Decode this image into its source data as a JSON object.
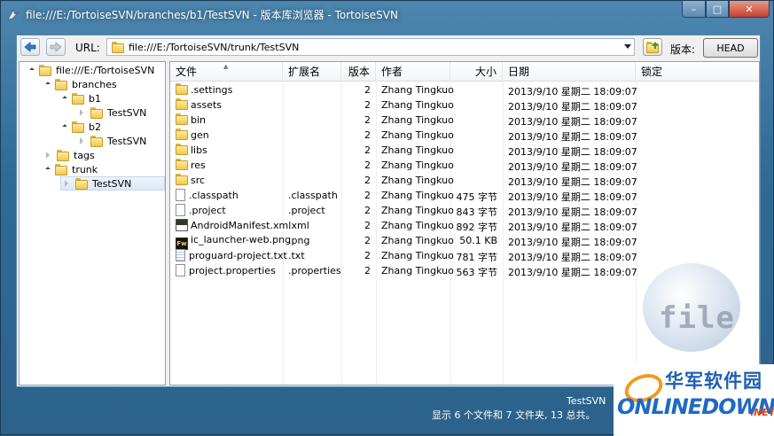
{
  "window": {
    "title": "file:///E:/TortoiseSVN/branches/b1/TestSVN - 版本库浏览器 - TortoiseSVN",
    "controls": {
      "minimize": "–",
      "maximize": "□",
      "close": "✕"
    }
  },
  "toolbar": {
    "url_label": "URL:",
    "url_value": "file:///E:/TortoiseSVN/trunk/TestSVN",
    "revision_label": "版本:",
    "revision_button": "HEAD"
  },
  "tree": {
    "nodes": [
      {
        "label": "file:///E:/TortoiseSVN"
      },
      {
        "label": "branches"
      },
      {
        "label": "b1"
      },
      {
        "label": "TestSVN"
      },
      {
        "label": "b2"
      },
      {
        "label": "TestSVN"
      },
      {
        "label": "tags"
      },
      {
        "label": "trunk"
      },
      {
        "label": "TestSVN",
        "selected": true
      }
    ]
  },
  "list": {
    "columns": [
      "文件",
      "扩展名",
      "版本",
      "作者",
      "大小",
      "日期",
      "锁定"
    ],
    "rows": [
      {
        "name": ".settings",
        "ext": "",
        "rev": "2",
        "author": "Zhang Tingkuo",
        "size": "",
        "date": "2013/9/10 星期二 18:09:07",
        "icon": "folder"
      },
      {
        "name": "assets",
        "ext": "",
        "rev": "2",
        "author": "Zhang Tingkuo",
        "size": "",
        "date": "2013/9/10 星期二 18:09:07",
        "icon": "folder"
      },
      {
        "name": "bin",
        "ext": "",
        "rev": "2",
        "author": "Zhang Tingkuo",
        "size": "",
        "date": "2013/9/10 星期二 18:09:07",
        "icon": "folder"
      },
      {
        "name": "gen",
        "ext": "",
        "rev": "2",
        "author": "Zhang Tingkuo",
        "size": "",
        "date": "2013/9/10 星期二 18:09:07",
        "icon": "folder"
      },
      {
        "name": "libs",
        "ext": "",
        "rev": "2",
        "author": "Zhang Tingkuo",
        "size": "",
        "date": "2013/9/10 星期二 18:09:07",
        "icon": "folder"
      },
      {
        "name": "res",
        "ext": "",
        "rev": "2",
        "author": "Zhang Tingkuo",
        "size": "",
        "date": "2013/9/10 星期二 18:09:07",
        "icon": "folder"
      },
      {
        "name": "src",
        "ext": "",
        "rev": "2",
        "author": "Zhang Tingkuo",
        "size": "",
        "date": "2013/9/10 星期二 18:09:07",
        "icon": "folder"
      },
      {
        "name": ".classpath",
        "ext": ".classpath",
        "rev": "2",
        "author": "Zhang Tingkuo",
        "size": "475 字节",
        "date": "2013/9/10 星期二 18:09:07",
        "icon": "file"
      },
      {
        "name": ".project",
        "ext": ".project",
        "rev": "2",
        "author": "Zhang Tingkuo",
        "size": "843 字节",
        "date": "2013/9/10 星期二 18:09:07",
        "icon": "file"
      },
      {
        "name": "AndroidManifest.xml",
        "ext": ".xml",
        "rev": "2",
        "author": "Zhang Tingkuo",
        "size": "892 字节",
        "date": "2013/9/10 星期二 18:09:07",
        "icon": "xml"
      },
      {
        "name": "ic_launcher-web.png",
        "ext": ".png",
        "rev": "2",
        "author": "Zhang Tingkuo",
        "size": "50.1 KB",
        "date": "2013/9/10 星期二 18:09:07",
        "icon": "png"
      },
      {
        "name": "proguard-project.txt",
        "ext": ".txt",
        "rev": "2",
        "author": "Zhang Tingkuo",
        "size": "781 字节",
        "date": "2013/9/10 星期二 18:09:07",
        "icon": "txt"
      },
      {
        "name": "project.properties",
        "ext": ".properties",
        "rev": "2",
        "author": "Zhang Tingkuo",
        "size": "563 字节",
        "date": "2013/9/10 星期二 18:09:07",
        "icon": "file"
      }
    ]
  },
  "watermark": {
    "text": "file"
  },
  "status": {
    "folder": "TestSVN",
    "summary": "显示 6 个文件和 7 文件夹, 13 总共。"
  },
  "logo": {
    "cn": "华军软件园",
    "en": "ONLINEDOWN",
    "suffix": ".NET"
  },
  "icons": {
    "png_badge": "Fw"
  }
}
